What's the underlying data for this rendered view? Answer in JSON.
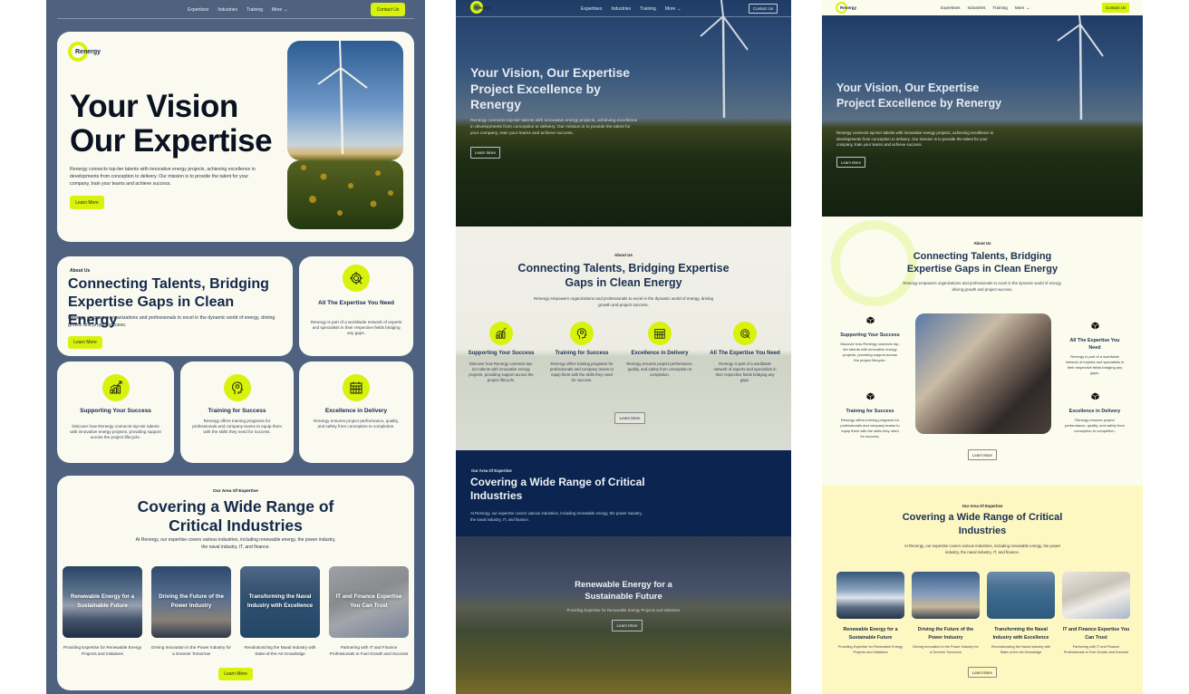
{
  "nav": {
    "links": [
      "Expertises",
      "Industries",
      "Training",
      "More"
    ],
    "contact_label": "Contact Us",
    "brand": "Renergy"
  },
  "colors": {
    "accent": "#d8f20c",
    "navy": "#14284a",
    "slate_bg": "#4e6280",
    "card_bg": "#fafaf0",
    "dark_band": "#0b2550",
    "cream_band": "#fdf7c2"
  },
  "variant_a": {
    "hero": {
      "title_line1": "Your Vision",
      "title_line2": "Our Expertise",
      "description": "Renergy connects top-tier talents with innovative energy projects, achieving excellence in developments from conception to delivery. Our mission is to provide the talent for your company, train your teams and achieve success.",
      "cta": "Learn More"
    },
    "about": {
      "eyebrow": "About Us",
      "title": "Connecting Talents, Bridging Expertise Gaps in Clean Energy",
      "description": "Renergy empowers organizations and professionals to excel in the dynamic world of energy, driving growth and project success.",
      "cta": "Learn More"
    },
    "industries": {
      "eyebrow": "Our Area Of Expertise",
      "title": "Covering a Wide Range of Critical Industries",
      "description": "At Renergy, our expertise covers various industries, including renewable energy, the power industry, the naval industry, IT, and finance.",
      "cta": "Learn More"
    }
  },
  "variant_b": {
    "hero": {
      "title": "Your Vision, Our Expertise Project Excellence by Renergy",
      "description": "Renergy connects top-tier talents with innovative energy projects, achieving excellence in developments from conception to delivery. Our mission is to provide the talent for your company, train your teams and achieve success.",
      "cta": "Learn More"
    },
    "about": {
      "eyebrow": "About Us",
      "title": "Connecting Talents, Bridging Expertise Gaps in Clean Energy",
      "description": "Renergy empowers organizations and professionals to excel in the dynamic world of energy, driving growth and project success.",
      "cta": "Learn More"
    },
    "industries": {
      "eyebrow": "Our Area Of Expertise",
      "title": "Covering a Wide Range of Critical Industries",
      "description": "At Renergy, our expertise covers various industries, including renewable energy, the power industry, the naval industry, IT, and finance."
    },
    "slide": {
      "title": "Renewable Energy for a Sustainable Future",
      "description": "Providing Expertise for Renewable Energy Projects and Initiatives",
      "cta": "Learn More"
    }
  },
  "variant_c": {
    "hero": {
      "title": "Your Vision, Our Expertise Project Excellence by Renergy",
      "description": "Renergy connects top-tier talents with innovative energy projects, achieving excellence in developments from conception to delivery. Our mission is to provide the talent for your company, train your teams and achieve success.",
      "cta": "Learn More"
    },
    "about": {
      "eyebrow": "About Us",
      "title": "Connecting Talents, Bridging Expertise Gaps in Clean Energy",
      "description": "Renergy empowers organizations and professionals to excel in the dynamic world of energy, driving growth and project success.",
      "cta": "Learn More"
    },
    "industries": {
      "eyebrow": "Our Area Of Expertise",
      "title": "Covering a Wide Range of Critical Industries",
      "description": "At Renergy, our expertise covers various industries, including renewable energy, the power industry, the naval industry, IT, and finance.",
      "cta": "Learn More"
    }
  },
  "features": [
    {
      "icon": "growth-chart-icon",
      "title": "Supporting Your Success",
      "description": "Discover how Renergy connects top-tier talents with innovative energy projects, providing support across the project lifecycle."
    },
    {
      "icon": "head-gear-icon",
      "title": "Training for Success",
      "description": "Renergy offers training programs for professionals and company teams to equip them with the skills they need for success."
    },
    {
      "icon": "calendar-icon",
      "title": "Excellence in Delivery",
      "description": "Renergy ensures project performance, quality, and safety from conception to completion."
    },
    {
      "icon": "target-icon",
      "title": "All The Expertise You Need",
      "description": "Renergy is part of a worldwide network of experts and specialists in their respective fields bridging any gaps."
    }
  ],
  "industries": [
    {
      "title": "Renewable Energy for a Sustainable Future",
      "description": "Providing Expertise for Renewable Energy Projects and Initiatives"
    },
    {
      "title": "Driving the Future of the Power Industry",
      "description": "Driving Innovation in the Power Industry for a Greener Tomorrow"
    },
    {
      "title": "Transforming the Naval Industry with Excellence",
      "description": "Revolutionizing the Naval Industry with State-of-the-Art Knowledge"
    },
    {
      "title": "IT and Finance Expertise You Can Trust",
      "description": "Partnering with IT and Finance Professionals to Fuel Growth and Success"
    }
  ]
}
